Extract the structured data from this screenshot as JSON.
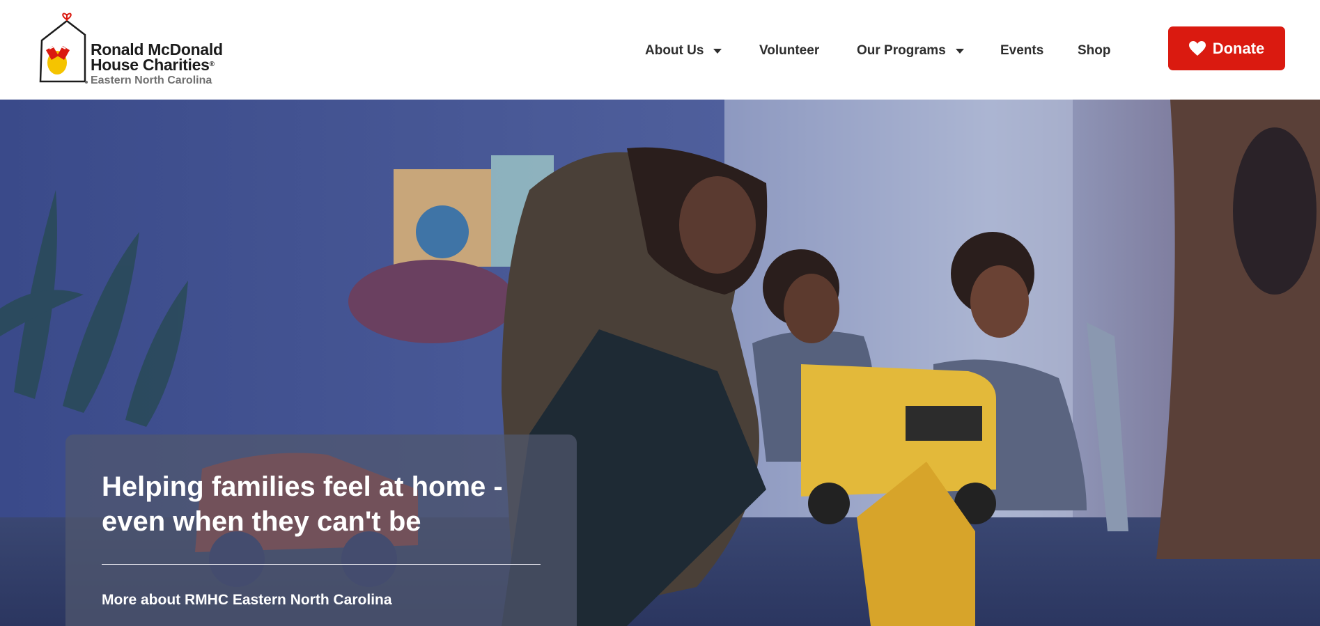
{
  "brand": {
    "line1": "Ronald McDonald",
    "line2": "House Charities",
    "line3": "Eastern North Carolina",
    "accent_color": "#da1a10"
  },
  "nav": {
    "about": "About Us",
    "volunteer": "Volunteer",
    "programs": "Our Programs",
    "events": "Events",
    "shop": "Shop"
  },
  "donate": {
    "label": "Donate",
    "icon": "heart-icon"
  },
  "hero": {
    "title": "Helping families feel at home - even when they can't be",
    "link": "More about RMHC Eastern North Carolina"
  }
}
